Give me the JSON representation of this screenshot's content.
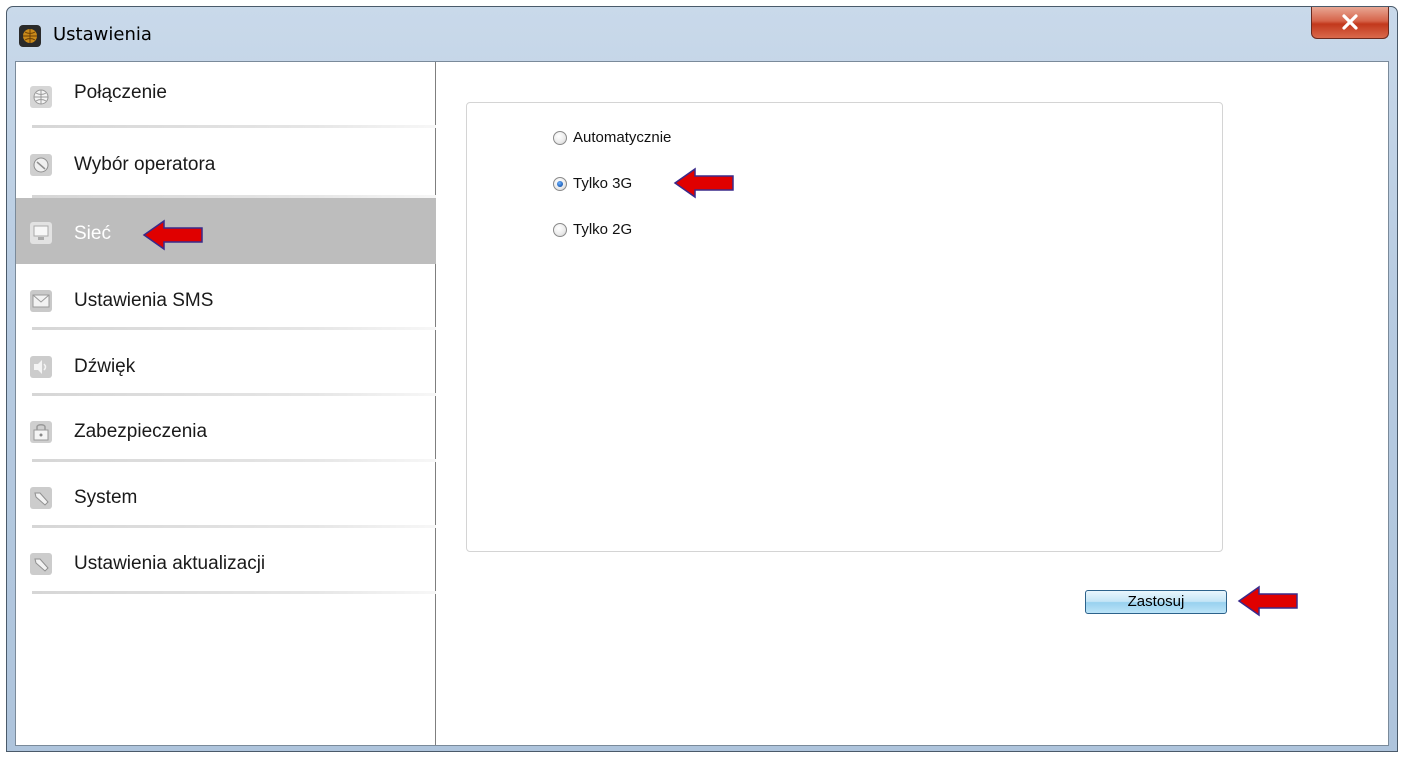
{
  "window": {
    "title": "Ustawienia",
    "accent_color": "#aec4dc",
    "close_color": "#c2381c"
  },
  "sidebar": {
    "items": [
      {
        "label": "Połączenie",
        "icon": "globe-icon"
      },
      {
        "label": "Wybór operatora",
        "icon": "operator-icon"
      },
      {
        "label": "Sieć",
        "icon": "monitor-icon",
        "selected": true
      },
      {
        "label": "Ustawienia SMS",
        "icon": "envelope-icon"
      },
      {
        "label": "Dźwięk",
        "icon": "speaker-icon"
      },
      {
        "label": "Zabezpieczenia",
        "icon": "lock-icon"
      },
      {
        "label": "System",
        "icon": "wrench-icon"
      },
      {
        "label": "Ustawienia aktualizacji",
        "icon": "wrench-icon"
      }
    ]
  },
  "network_mode": {
    "options": [
      {
        "label": "Automatycznie",
        "checked": false
      },
      {
        "label": "Tylko 3G",
        "checked": true
      },
      {
        "label": "Tylko 2G",
        "checked": false
      }
    ]
  },
  "actions": {
    "apply_label": "Zastosuj"
  },
  "annotations": {
    "arrow_color": "#e00000",
    "arrow_icon": "red-arrow-icon"
  }
}
